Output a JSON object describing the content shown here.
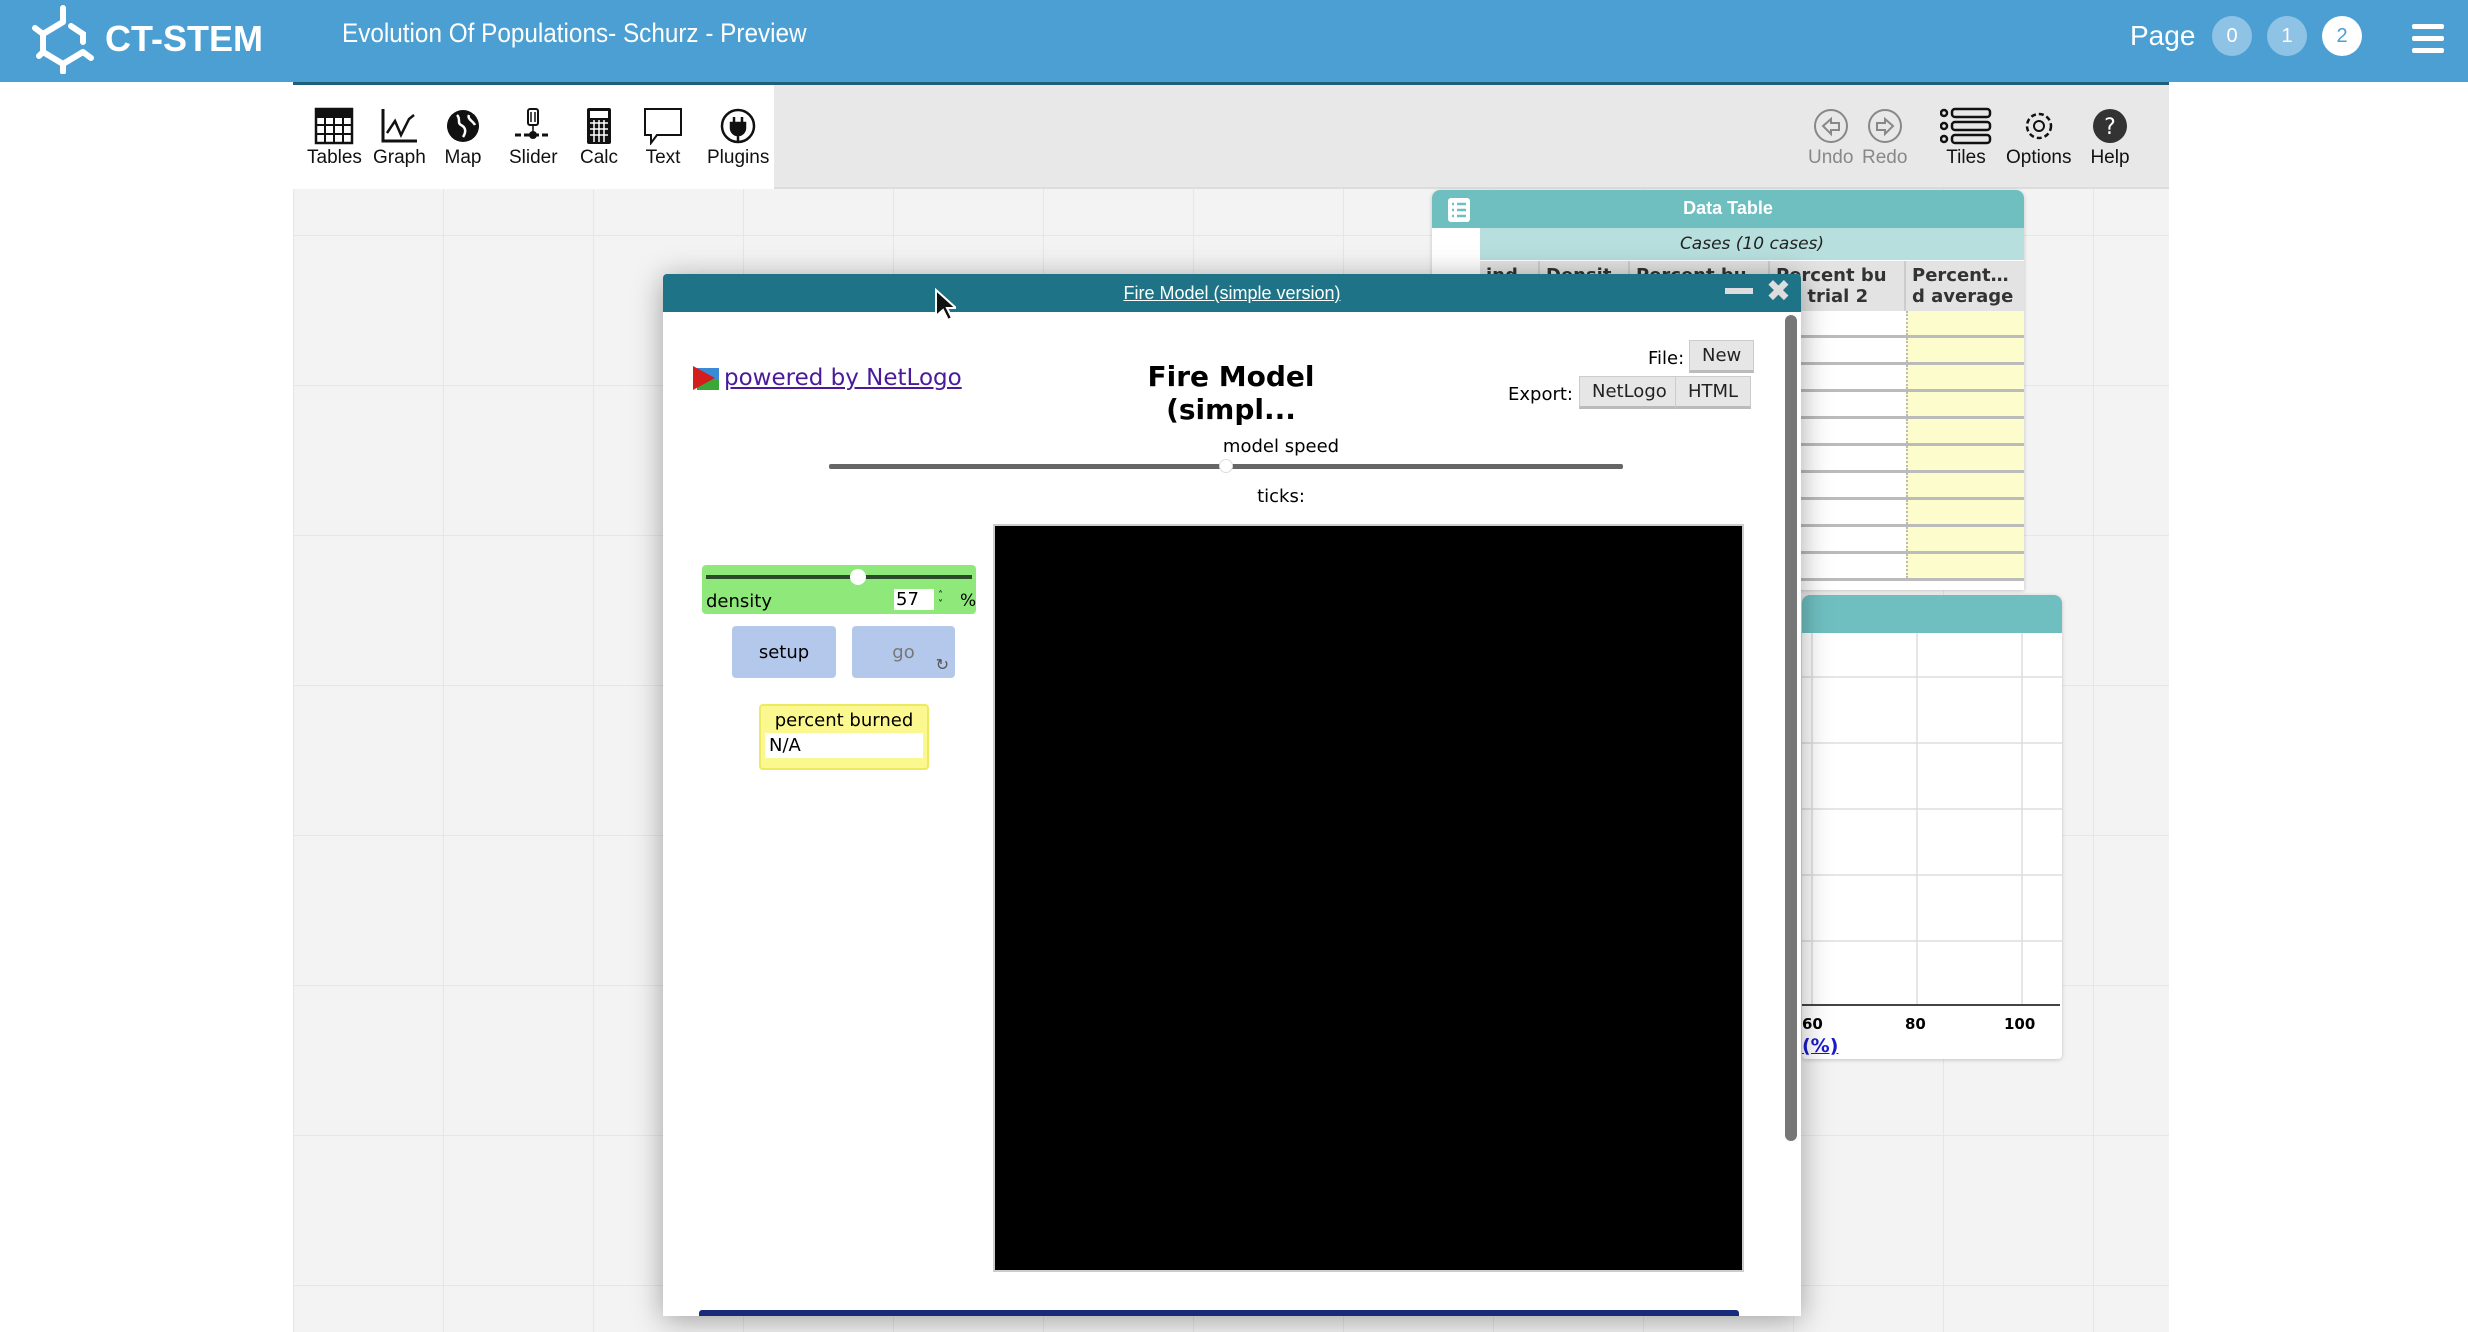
{
  "header": {
    "logo": "CT-STEM",
    "title": "Evolution Of Populations- Schurz - Preview",
    "page_label": "Page",
    "pages": [
      "0",
      "1",
      "2"
    ],
    "current_page": "2"
  },
  "toolbar": {
    "left": [
      "Tables",
      "Graph",
      "Map",
      "Slider",
      "Calc",
      "Text",
      "Plugins"
    ],
    "undo": "Undo",
    "redo": "Redo",
    "tiles": "Tiles",
    "options": "Options",
    "help": "Help"
  },
  "data_table": {
    "title": "Data Table",
    "cases": "Cases (10 cases)",
    "columns": [
      "ind",
      "Densit",
      "Percent bu",
      "Percent bu\ned trial 2",
      "Percent…\nd average"
    ],
    "row_count": 10,
    "highlight_color": "#fdfccd"
  },
  "graph": {
    "x_ticks": [
      "60",
      "80",
      "100"
    ],
    "x_label": "(%)"
  },
  "fire_model": {
    "window_title": "Fire Model (simple version)",
    "powered_by": "powered by NetLogo",
    "model_title": "Fire Model (simpl...",
    "file_label": "File:",
    "new_btn": "New",
    "export_label": "Export:",
    "export_netlogo": "NetLogo",
    "export_html": "HTML",
    "speed_label": "model speed",
    "ticks_label": "ticks:",
    "density": {
      "label": "density",
      "value": "57",
      "unit": "%",
      "min": 0,
      "max": 99
    },
    "setup": "setup",
    "go": "go",
    "monitor": {
      "label": "percent burned",
      "value": "N/A"
    }
  },
  "colors": {
    "header": "#4b9fd3",
    "window_bar": "#1e7486",
    "tile_header": "#6fbfc1",
    "slider_green": "#8ee87a"
  }
}
